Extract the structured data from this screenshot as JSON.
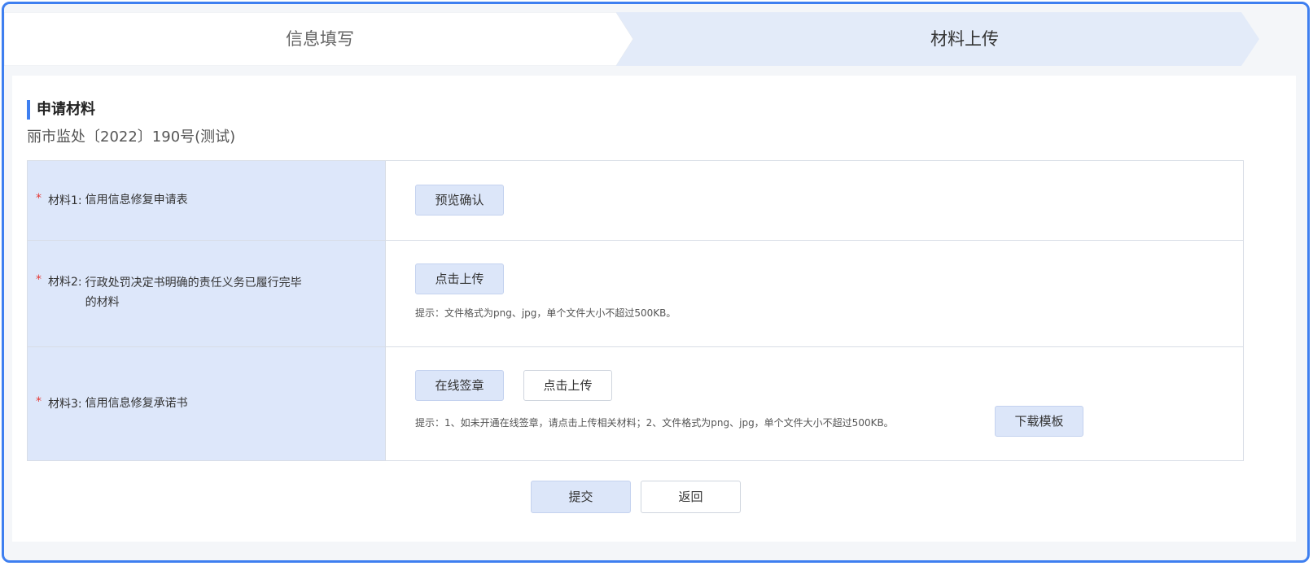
{
  "steps": [
    {
      "label": "信息填写",
      "active": false
    },
    {
      "label": "材料上传",
      "active": true
    }
  ],
  "section": {
    "title": "申请材料",
    "doc_number": "丽市监处〔2022〕190号(测试)"
  },
  "materials": [
    {
      "required_mark": "*",
      "number": "材料1:",
      "name": "信用信息修复申请表",
      "buttons": [
        "预览确认"
      ],
      "hint": ""
    },
    {
      "required_mark": "*",
      "number": "材料2:",
      "name_line1": "行政处罚决定书明确的责任义务已履行完毕",
      "name_line2": "的材料",
      "buttons": [
        "点击上传"
      ],
      "hint": "提示：文件格式为png、jpg，单个文件大小不超过500KB。"
    },
    {
      "required_mark": "*",
      "number": "材料3:",
      "name": "信用信息修复承诺书",
      "buttons": [
        "在线签章",
        "点击上传"
      ],
      "hint": "提示：1、如未开通在线签章，请点击上传相关材料；2、文件格式为png、jpg，单个文件大小不超过500KB。",
      "template_button": "下载模板"
    }
  ],
  "actions": {
    "submit": "提交",
    "back": "返回"
  },
  "colors": {
    "accent": "#3e7ff0",
    "label_bg": "#dde7fa",
    "required": "#e53935"
  }
}
